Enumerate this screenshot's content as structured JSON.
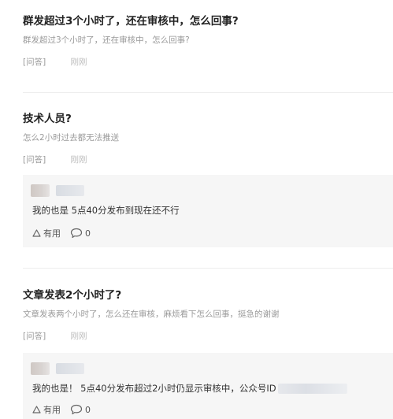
{
  "questions": [
    {
      "title": "群发超过3个小时了，还在审核中，怎么回事?",
      "description": "群发超过3个小时了，还在审核中，怎么回事?",
      "tag": "[问答]",
      "time": "刚刚"
    },
    {
      "title": "技术人员?",
      "description": "怎么2小时过去都无法推送",
      "tag": "[问答]",
      "time": "刚刚",
      "answer": {
        "text": "我的也是 5点40分发布到现在还不行",
        "useful_label": "有用",
        "comment_count": "0"
      }
    },
    {
      "title": "文章发表2个小时了?",
      "description": "文章发表两个小时了，怎么还在审核，麻烦看下怎么回事，挺急的谢谢",
      "tag": "[问答]",
      "time": "刚刚",
      "answer": {
        "text": "我的也是！ 5点40分发布超过2小时仍显示审核中，公众号ID",
        "useful_label": "有用",
        "comment_count": "0"
      }
    }
  ]
}
